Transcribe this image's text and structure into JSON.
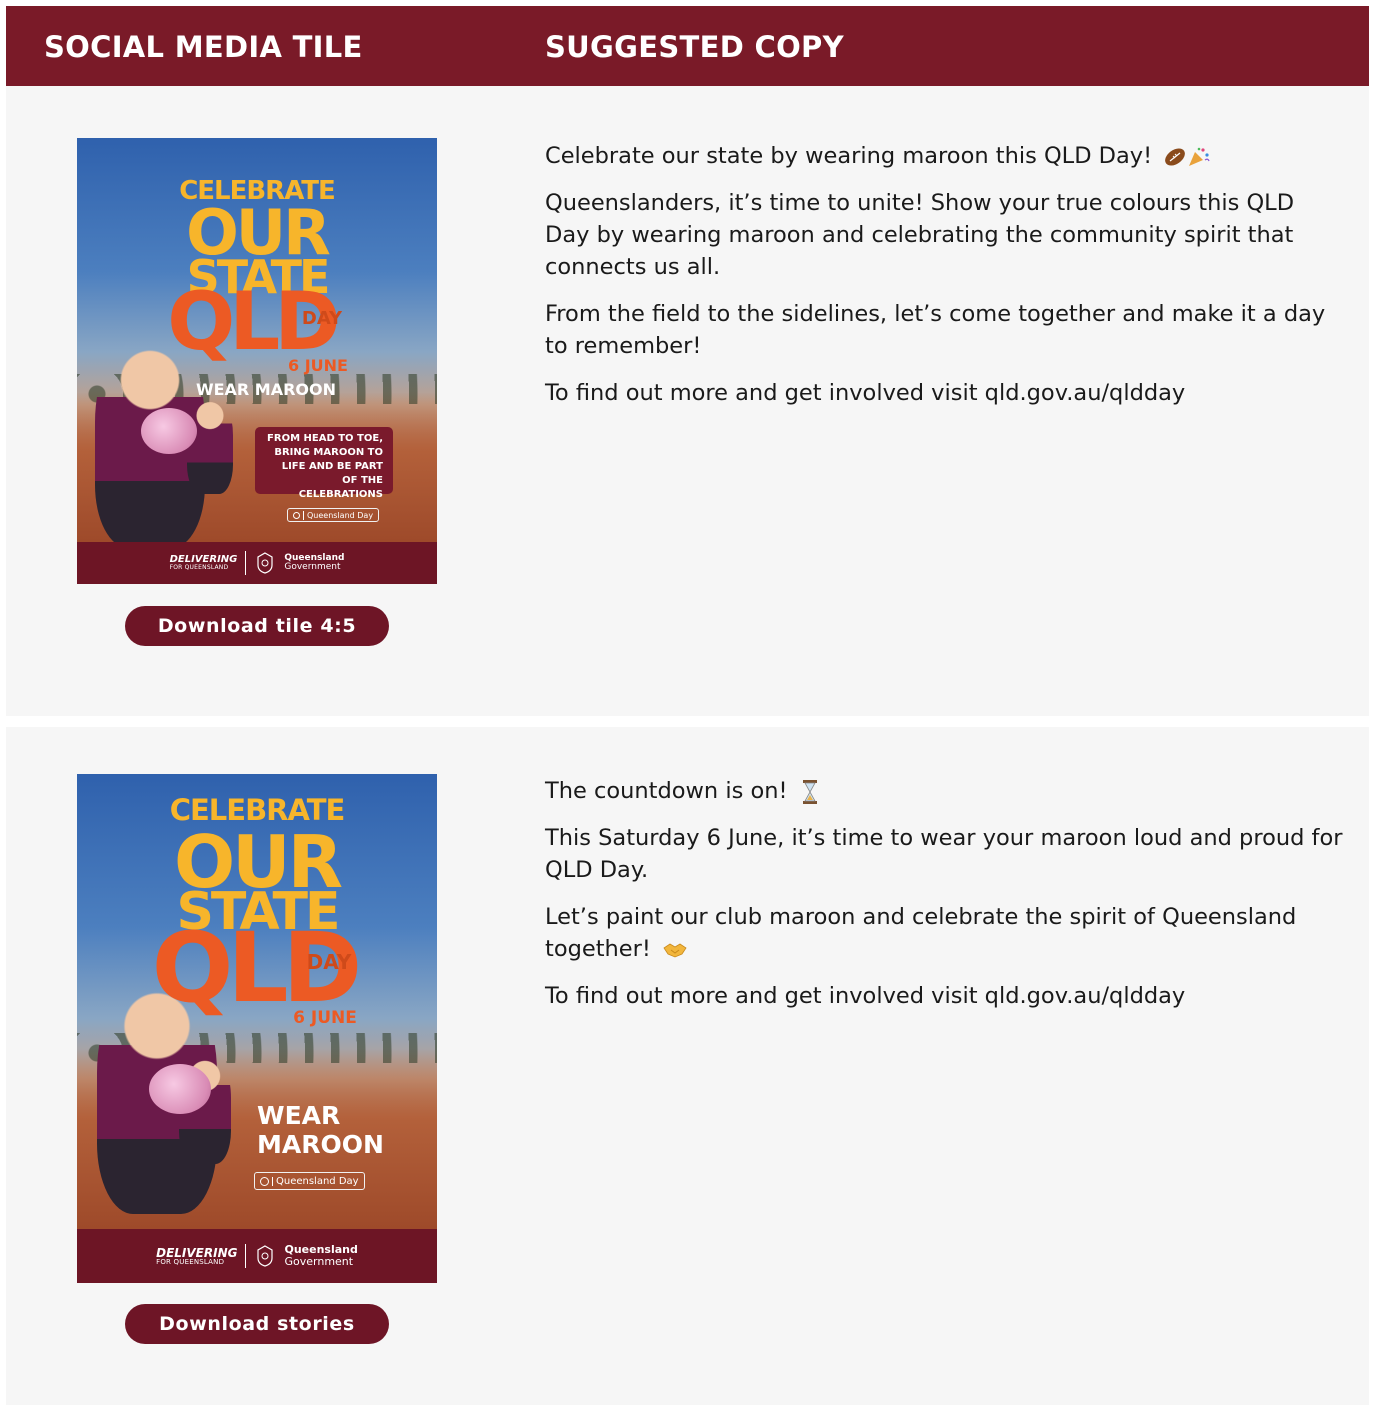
{
  "header": {
    "col1": "SOCIAL MEDIA TILE",
    "col2": "SUGGESTED COPY"
  },
  "colors": {
    "maroon": "#7a1a28",
    "button": "#6e1526",
    "orange": "#ec5a24",
    "yellow": "#f7b52b",
    "panel": "#f6f6f6"
  },
  "rows": [
    {
      "tile": {
        "line1": "CELEBRATE",
        "line2": "OUR",
        "line3": "STATE",
        "line4": "QLD",
        "day": "DAY",
        "date": "6 JUNE",
        "wear": "WEAR MAROON",
        "callout": "FROM HEAD TO TOE, BRING MAROON TO LIFE AND BE PART OF THE CELEBRATIONS",
        "search": "Queensland Day",
        "brand1": "DELIVERING",
        "brand1_sub": "FOR QUEENSLAND",
        "brand2": "Queensland",
        "brand2_sub": "Government"
      },
      "button": "Download tile 4:5",
      "copy": [
        "Celebrate our state by wearing maroon this QLD Day!",
        "Queenslanders, it’s time to unite! Show your true colours this QLD Day by wearing maroon and celebrating the community spirit that connects us all.",
        "From the field to the sidelines, let’s come together and make it a day to remember!",
        "To find out more and get involved visit qld.gov.au/qldday"
      ],
      "copy_icons": [
        "football-icon",
        "party-popper-icon"
      ]
    },
    {
      "tile": {
        "line1": "CELEBRATE",
        "line2": "OUR",
        "line3": "STATE",
        "line4": "QLD",
        "day": "DAY",
        "date": "6 JUNE",
        "wear1": "WEAR",
        "wear2": "MAROON",
        "search": "Queensland Day",
        "brand1": "DELIVERING",
        "brand1_sub": "FOR QUEENSLAND",
        "brand2": "Queensland",
        "brand2_sub": "Government"
      },
      "button": "Download stories",
      "copy": [
        "The countdown is on!",
        "This Saturday 6 June, it’s time to wear your maroon loud and proud for QLD Day.",
        "Let’s paint our club maroon and celebrate the spirit of Queensland together!",
        "To find out more and get involved visit qld.gov.au/qldday"
      ],
      "copy_icons": [
        "hourglass-icon",
        "handshake-icon"
      ]
    }
  ]
}
